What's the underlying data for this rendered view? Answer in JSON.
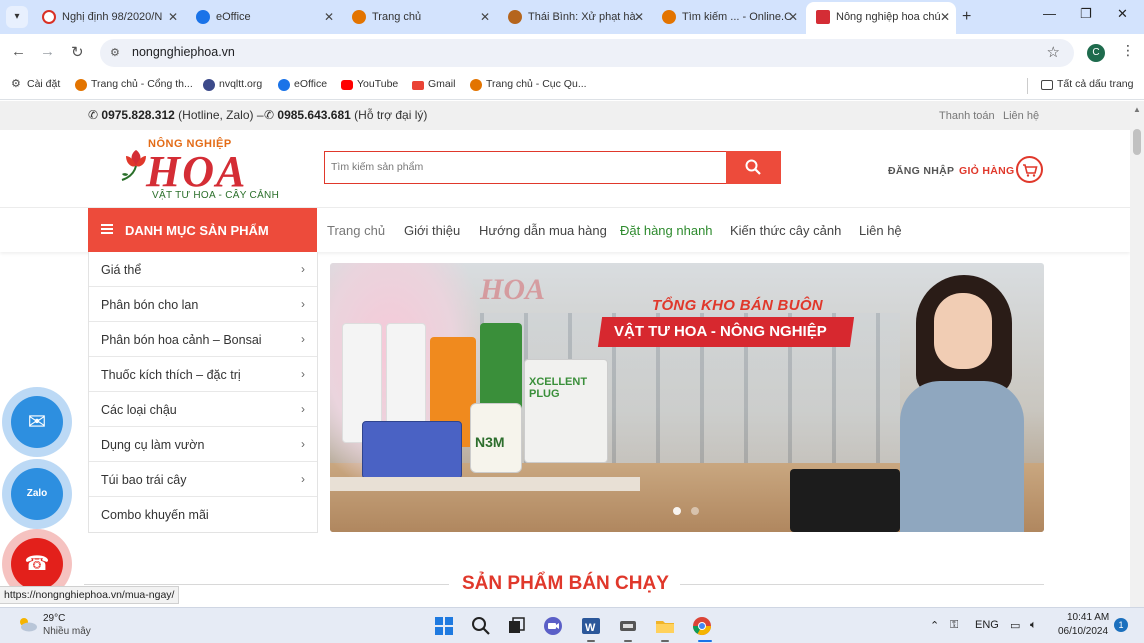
{
  "browser": {
    "tabs": [
      {
        "title": "Nghị định 98/2020/N",
        "favicon_color": "#d93025"
      },
      {
        "title": "eOffice",
        "favicon_color": "#1a73e8"
      },
      {
        "title": "Trang chủ",
        "favicon_color": "#e37400"
      },
      {
        "title": "Thái Bình: Xử phạt hà",
        "favicon_color": "#c0392b"
      },
      {
        "title": "Tìm kiếm ... - Online.C",
        "favicon_color": "#e37400"
      },
      {
        "title": "Nông nghiệp hoa chú",
        "favicon_color": "#d42d35",
        "active": true
      }
    ],
    "new_tab_glyph": "+",
    "close_glyph": "✕",
    "window_controls": {
      "minimize": "—",
      "restore": "❐",
      "close": "✕"
    },
    "url": "nongnghiephoa.vn",
    "profile_initial": "C",
    "bookmarks": [
      {
        "label": "Cài đặt",
        "icon": "gear-icon",
        "color": "#444"
      },
      {
        "label": "Trang chủ - Cổng th...",
        "icon": "site-icon",
        "color": "#e37400"
      },
      {
        "label": "nvqltt.org",
        "icon": "globe-icon",
        "color": "#3c4a8a"
      },
      {
        "label": "eOffice",
        "icon": "eoffice-icon",
        "color": "#1a73e8"
      },
      {
        "label": "YouTube",
        "icon": "youtube-icon",
        "color": "#ff0000"
      },
      {
        "label": "Gmail",
        "icon": "gmail-icon",
        "color": "#ea4335"
      },
      {
        "label": "Trang chủ - Cục Qu...",
        "icon": "site-icon",
        "color": "#e37400"
      }
    ],
    "all_bookmarks_label": "Tất cả dấu trang",
    "status_url": "https://nongnghiephoa.vn/mua-ngay/"
  },
  "site": {
    "topbar": {
      "hotline_number": "0975.828.312",
      "hotline_note": "(Hotline, Zalo) –",
      "agent_number": "0985.643.681",
      "agent_note": "(Hỗ trợ đại lý)",
      "links": [
        "Thanh toán",
        "Liên hệ"
      ]
    },
    "logo": {
      "line1": "NÔNG NGHIỆP",
      "brand": "HOA",
      "tagline": "VẬT TƯ HOA - CÂY CẢNH"
    },
    "search_placeholder": "Tìm kiếm sản phẩm",
    "login_label": "ĐĂNG NHẬP",
    "cart_label": "GIỎ HÀNG",
    "category_heading": "DANH MỤC SẢN PHẨM",
    "menu": [
      "Trang chủ",
      "Giới thiệu",
      "Hướng dẫn mua hàng",
      "Đặt hàng nhanh",
      "Kiến thức cây cảnh",
      "Liên hệ"
    ],
    "categories": [
      {
        "label": "Giá thể",
        "has_sub": true
      },
      {
        "label": "Phân bón cho lan",
        "has_sub": true
      },
      {
        "label": "Phân bón hoa cảnh – Bonsai",
        "has_sub": true
      },
      {
        "label": "Thuốc kích thích – đặc trị",
        "has_sub": true
      },
      {
        "label": "Các loại chậu",
        "has_sub": true
      },
      {
        "label": "Dụng cụ làm vườn",
        "has_sub": true
      },
      {
        "label": "Túi bao trái cây",
        "has_sub": true
      },
      {
        "label": "Combo khuyến mãi",
        "has_sub": false
      }
    ],
    "banner": {
      "watermark": "HOA",
      "slogan_top": "TỔNG KHO BÁN BUÔN",
      "slogan_main": "VẬT TƯ HOA - NÔNG NGHIỆP",
      "product_labels": [
        "XCELLENT PLUG",
        "N3M"
      ],
      "slide_count": 2,
      "active_slide": 1
    },
    "best_sellers_heading": "SẢN PHẨM BÁN CHẠY",
    "floating_contacts": [
      {
        "name": "email",
        "label": "✉",
        "color": "#2d8fe0",
        "ring": "#bcd9f5"
      },
      {
        "name": "zalo",
        "label": "Zalo",
        "color": "#2d8fe0",
        "ring": "#bcd9f5"
      },
      {
        "name": "phone",
        "label": "☎",
        "color": "#e3201b",
        "ring": "#f5c2c0"
      }
    ],
    "chevron_glyph": "›"
  },
  "taskbar": {
    "temperature": "29°C",
    "weather": "Nhiều mây",
    "language": "ENG",
    "time": "10:41 AM",
    "date": "06/10/2024",
    "notifications": "1",
    "apps": [
      {
        "name": "start",
        "color": "#1f7ae0"
      },
      {
        "name": "search",
        "color": "#222"
      },
      {
        "name": "task-view",
        "color": "#222"
      },
      {
        "name": "meet",
        "color": "#5b5fc7"
      },
      {
        "name": "word",
        "color": "#2b579a"
      },
      {
        "name": "app",
        "color": "#555"
      },
      {
        "name": "file-explorer",
        "color": "#f0b429"
      },
      {
        "name": "chrome",
        "color": "#1a73e8"
      }
    ]
  },
  "colors": {
    "accent": "#ed4b3b",
    "brand_red": "#d42d35",
    "green": "#2e8b2e"
  }
}
